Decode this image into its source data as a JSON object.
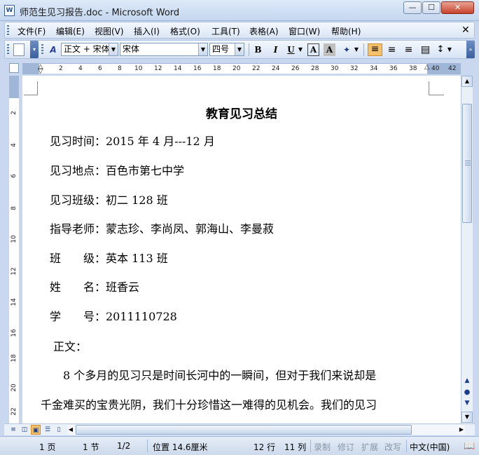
{
  "window": {
    "title": "师范生见习报告.doc - Microsoft Word",
    "minimize": "—",
    "maximize": "☐",
    "close": "✕"
  },
  "menu": {
    "items": [
      "文件(F)",
      "编辑(E)",
      "视图(V)",
      "插入(I)",
      "格式(O)",
      "工具(T)",
      "表格(A)",
      "窗口(W)",
      "帮助(H)"
    ],
    "close": "✕"
  },
  "toolbar": {
    "style_value": "正文 + 宋体",
    "font_value": "宋体",
    "size_value": "四号",
    "bold": "B",
    "italic": "I",
    "underline": "U",
    "border_char": "A",
    "shade_char": "A"
  },
  "ruler": {
    "h_ticks": [
      "2",
      "2",
      "4",
      "6",
      "8",
      "10",
      "12",
      "14",
      "16",
      "18",
      "20",
      "22",
      "24",
      "26",
      "28",
      "30",
      "32",
      "34",
      "36",
      "38",
      "40",
      "42"
    ],
    "v_ticks": [
      "2",
      "4",
      "6",
      "8",
      "10",
      "12",
      "14",
      "16",
      "18",
      "20",
      "22"
    ]
  },
  "document": {
    "title": "教育见习总结",
    "lines": [
      "见习时间：2015 年 4 月---12 月",
      "见习地点：百色市第七中学",
      "见习班级：初二 128 班",
      "指导老师：蒙志珍、李尚凤、郭海山、李曼菽",
      "班　　级：英本 113 班",
      "姓　　名：班香云",
      "学　　号：2011110728",
      " 正文：",
      "　　8 个多月的见习只是时间长河中的一瞬间，但对于我们来说却是",
      "千金难买的宝贵光阴，我们十分珍惜这一难得的见机会。我们的见习"
    ]
  },
  "status": {
    "page": "1 页",
    "section": "1 节",
    "page_of": "1/2",
    "position": "位置 14.6厘米",
    "line": "12 行",
    "column": "11 列",
    "rec": "录制",
    "trk": "修订",
    "ext": "扩展",
    "ovr": "改写",
    "language": "中文(中国)"
  }
}
